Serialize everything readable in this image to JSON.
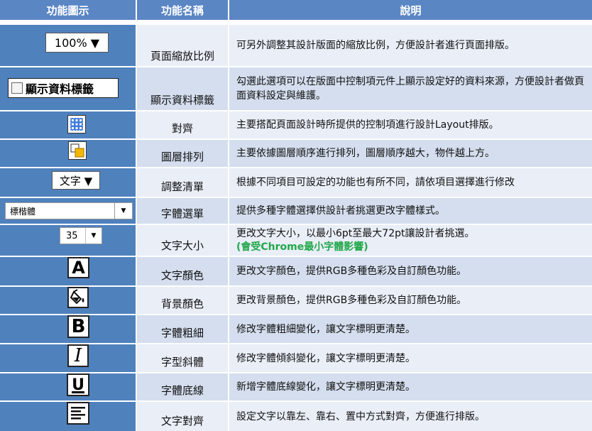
{
  "headers": {
    "icon": "功能圖示",
    "name": "功能名稱",
    "desc": "說明"
  },
  "rows": [
    {
      "name": "頁面縮放比例",
      "desc": "可另外調整其設計版面的縮放比例，方便設計者進行頁面排版。",
      "icon_text": "100% ▼"
    },
    {
      "name": "顯示資料標籤",
      "desc": "勾選此選項可以在版面中控制項元件上顯示設定好的資料來源，方便設計者做頁面資料設定與維護。",
      "icon_text": "顯示資料標籤"
    },
    {
      "name": "對齊",
      "desc": "主要搭配頁面設計時所提供的控制項進行設計Layout排版。"
    },
    {
      "name": "圖層排列",
      "desc": "主要依據圖層順序進行排列，圖層順序越大，物件越上方。"
    },
    {
      "name": "調整清單",
      "desc": "根據不同項目可設定的功能也有所不同，請依項目選擇進行修改",
      "icon_text": "文字 ▼"
    },
    {
      "name": "字體選單",
      "desc": "提供多種字體選擇供設計者挑選更改字體樣式。",
      "icon_text": "標楷體"
    },
    {
      "name": "文字大小",
      "desc": "更改文字大小，以最小6pt至最大72pt讓設計者挑選。",
      "note": "(會受Chrome最小字體影響)",
      "icon_text": "35"
    },
    {
      "name": "文字顏色",
      "desc": "更改文字顏色，提供RGB多種色彩及自訂顏色功能。",
      "icon_text": "A"
    },
    {
      "name": "背景顏色",
      "desc": "更改背景顏色，提供RGB多種色彩及自訂顏色功能。"
    },
    {
      "name": "字體粗細",
      "desc": "修改字體粗細變化，讓文字標明更清楚。",
      "icon_text": "B"
    },
    {
      "name": "字型斜體",
      "desc": "修改字體傾斜變化，讓文字標明更清楚。",
      "icon_text": "I"
    },
    {
      "name": "字體底線",
      "desc": "新增字體底線變化，讓文字標明更清楚。",
      "icon_text": "U"
    },
    {
      "name": "文字對齊",
      "desc": "設定文字以靠左、靠右、置中方式對齊，方便進行排版。"
    }
  ]
}
